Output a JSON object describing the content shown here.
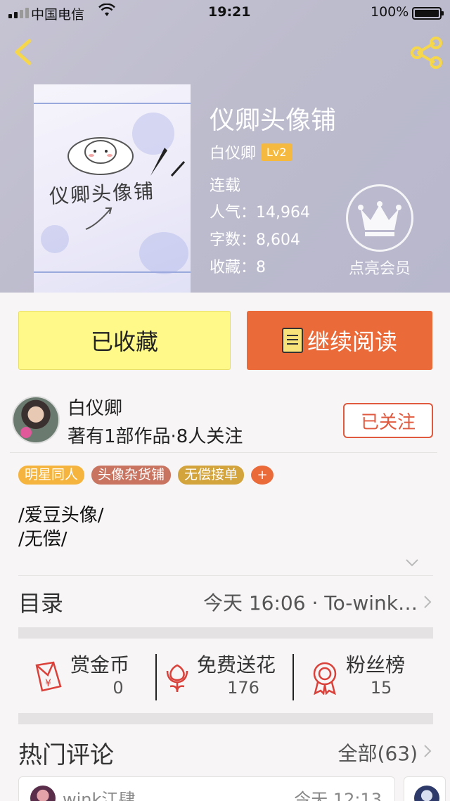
{
  "status_bar": {
    "carrier": "中国电信",
    "time": "19:21",
    "battery": "100%"
  },
  "book": {
    "cover_text": "仪卿头像铺",
    "title": "仪卿头像铺",
    "author": "白仪卿",
    "level": "Lv2",
    "status": "连载",
    "popularity": "人气：14,964",
    "word_count": "字数：8,604",
    "favorites": "收藏：8"
  },
  "vip": {
    "label": "点亮会员",
    "icon": "crown-icon"
  },
  "actions": {
    "favorited_label": "已收藏",
    "read_label": "继续阅读"
  },
  "author_card": {
    "name": "白仪卿",
    "stats": "著有1部作品·8人关注",
    "follow_label": "已关注"
  },
  "tags": [
    {
      "label": "明星同人",
      "color": "#f5b43d"
    },
    {
      "label": "头像杂货铺",
      "color": "#c97460"
    },
    {
      "label": "无偿接单",
      "color": "#d4a43c"
    }
  ],
  "tag_add": "+",
  "description": {
    "line1": "/爱豆头像/",
    "line2": "/无偿/"
  },
  "toc": {
    "label": "目录",
    "latest": "今天 16:06 · To-wink…"
  },
  "stats": [
    {
      "label": "赏金币",
      "value": "0",
      "icon": "red-envelope-icon"
    },
    {
      "label": "免费送花",
      "value": "176",
      "icon": "flower-icon"
    },
    {
      "label": "粉丝榜",
      "value": "15",
      "icon": "medal-icon"
    }
  ],
  "hot_comments": {
    "title": "热门评论",
    "all_label": "全部(63)"
  },
  "comments": [
    {
      "user": "wink江肆",
      "time": "今天 12:13"
    }
  ],
  "colors": {
    "accent_orange": "#ea6a3a",
    "fav_yellow": "#fff98a",
    "follow_red": "#e05a40"
  }
}
